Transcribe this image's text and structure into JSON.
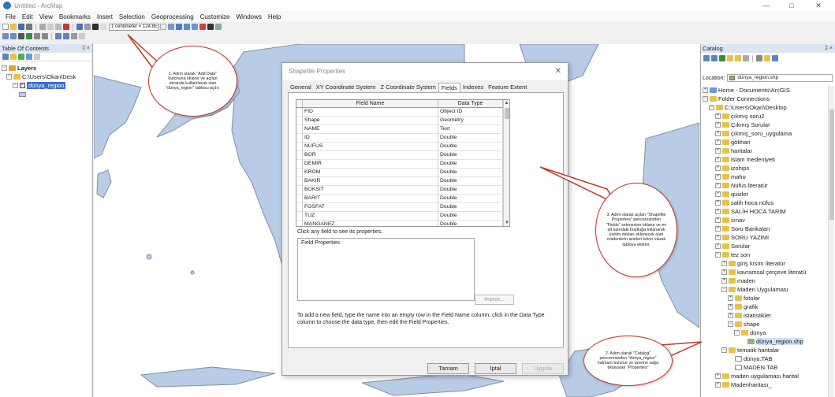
{
  "window": {
    "title": "Untitled - ArcMap"
  },
  "menubar": [
    "File",
    "Edit",
    "View",
    "Bookmarks",
    "Insert",
    "Selection",
    "Geoprocessing",
    "Customize",
    "Windows",
    "Help"
  ],
  "toolbar": {
    "scale_value": "1 centimeter = 124.8E"
  },
  "toc": {
    "title": "Table Of Contents",
    "pin": "‡ ×",
    "layers_label": "Layers",
    "folder_label": "C:\\Users\\Okan\\Desk",
    "layer_name": "dünya_region"
  },
  "catalog": {
    "title": "Catalog",
    "pin": "‡ ×",
    "location_label": "Location:",
    "location_value": "dünya_region.shp",
    "tree": [
      {
        "label": "Home - Documents\\ArcGIS",
        "indent": 0,
        "exp": "+"
      },
      {
        "label": "Folder Connections",
        "indent": 0,
        "exp": "−"
      },
      {
        "label": "C:\\Users\\Okan\\Desktop",
        "indent": 1,
        "exp": "−"
      },
      {
        "label": "çıkmış soru2",
        "indent": 2,
        "exp": "+"
      },
      {
        "label": "Çıkmış Sorular",
        "indent": 2,
        "exp": "+"
      },
      {
        "label": "çıkmış_soru_uygulama",
        "indent": 2,
        "exp": "+"
      },
      {
        "label": "gökhan",
        "indent": 2,
        "exp": "+"
      },
      {
        "label": "haritalar",
        "indent": 2,
        "exp": "+"
      },
      {
        "label": "islam medeniyeti",
        "indent": 2,
        "exp": "+"
      },
      {
        "label": "izohips",
        "indent": 2,
        "exp": "+"
      },
      {
        "label": "maho",
        "indent": 2,
        "exp": "+"
      },
      {
        "label": "Nüfus literatür",
        "indent": 2,
        "exp": "+"
      },
      {
        "label": "quizler",
        "indent": 2,
        "exp": "+"
      },
      {
        "label": "salih hoca nüfus",
        "indent": 2,
        "exp": "+"
      },
      {
        "label": "SALİH HOCA TARIM",
        "indent": 2,
        "exp": "+"
      },
      {
        "label": "sınav",
        "indent": 2,
        "exp": "+"
      },
      {
        "label": "Soru Bankaları",
        "indent": 2,
        "exp": "+"
      },
      {
        "label": "SORU YAZIMI",
        "indent": 2,
        "exp": "+"
      },
      {
        "label": "Sorular",
        "indent": 2,
        "exp": "+"
      },
      {
        "label": "tez son",
        "indent": 2,
        "exp": "−"
      },
      {
        "label": "giriş kısmı literatür",
        "indent": 3,
        "exp": "+"
      },
      {
        "label": "kavramsal çerçeve literatü",
        "indent": 3,
        "exp": "+"
      },
      {
        "label": "maden",
        "indent": 3,
        "exp": "+"
      },
      {
        "label": "Maden Uygulaması",
        "indent": 3,
        "exp": "−"
      },
      {
        "label": "fotolar",
        "indent": 4,
        "exp": "+"
      },
      {
        "label": "grafik",
        "indent": 4,
        "exp": "+"
      },
      {
        "label": "istatistikler",
        "indent": 4,
        "exp": "+"
      },
      {
        "label": "shape",
        "indent": 4,
        "exp": "−"
      },
      {
        "label": "dünya",
        "indent": 5,
        "exp": "−"
      },
      {
        "label": "dünya_region.shp",
        "indent": 6,
        "exp": "",
        "selected": true
      },
      {
        "label": "tematik haritalar",
        "indent": 3,
        "exp": "−"
      },
      {
        "label": "dünya.TAB",
        "indent": 4,
        "exp": ""
      },
      {
        "label": "MADEN.TAB",
        "indent": 4,
        "exp": ""
      },
      {
        "label": "maden uygulaması harital",
        "indent": 2,
        "exp": "+"
      },
      {
        "label": "Madenharitası_",
        "indent": 2,
        "exp": "+"
      }
    ]
  },
  "dialog": {
    "title": "Shapefile Properties",
    "close": "✕",
    "tabs": [
      "General",
      "XY Coordinate System",
      "Z Coordinate System",
      "Fields",
      "Indexes",
      "Feature Extent"
    ],
    "active_tab": "Fields",
    "columns": [
      "Field Name",
      "Data Type"
    ],
    "fields": [
      {
        "name": "FID",
        "type": "Object ID"
      },
      {
        "name": "Shape",
        "type": "Geometry"
      },
      {
        "name": "NAME",
        "type": "Text"
      },
      {
        "name": "ID",
        "type": "Double"
      },
      {
        "name": "NUFUS",
        "type": "Double"
      },
      {
        "name": "BOR",
        "type": "Double"
      },
      {
        "name": "DEMIR",
        "type": "Double"
      },
      {
        "name": "KROM",
        "type": "Double"
      },
      {
        "name": "BAKIR",
        "type": "Double"
      },
      {
        "name": "BOKSIT",
        "type": "Double"
      },
      {
        "name": "BARIT",
        "type": "Double"
      },
      {
        "name": "FOSFAT",
        "type": "Double"
      },
      {
        "name": "TUZ",
        "type": "Double"
      },
      {
        "name": "MANGANEZ",
        "type": "Double"
      }
    ],
    "click_hint": "Click any field to see its properties.",
    "field_properties_label": "Field Properties",
    "import_label": "Import...",
    "help_text": "To add a new field, type the name into an empty row in the Field Name column, click in the Data Type column to choose the data type, then edit the Field Properties.",
    "buttons": {
      "ok": "Tamam",
      "cancel": "İptal",
      "apply": "Uygula"
    }
  },
  "callouts": {
    "step1": "1. Adım olarak \"Add Data\" butonuna tıklanır ve açılan ekranda kullanılacak olan \"dünya_region\" tablosu açılır.",
    "step3": "3. Adım olarak açılan \"Shapefile Properties\" penceresinden \"Fields\" sekmesine tıklanır ve en alt satırdaki boşfluğa tıklanarak üretim miktarı eklenecek olan madenlerin isimleri kolon olarak tabloya eklenir.",
    "step2": "2. Adım olarak \"Catalog\" penceresinden \"dünya_region\" katmanı bulunur ve üzerine sağa tıklayarak \"Properties\""
  },
  "colors": {
    "callout_border": "#c0392b",
    "land": "#b9cce6",
    "selection": "#3a6fd0"
  }
}
